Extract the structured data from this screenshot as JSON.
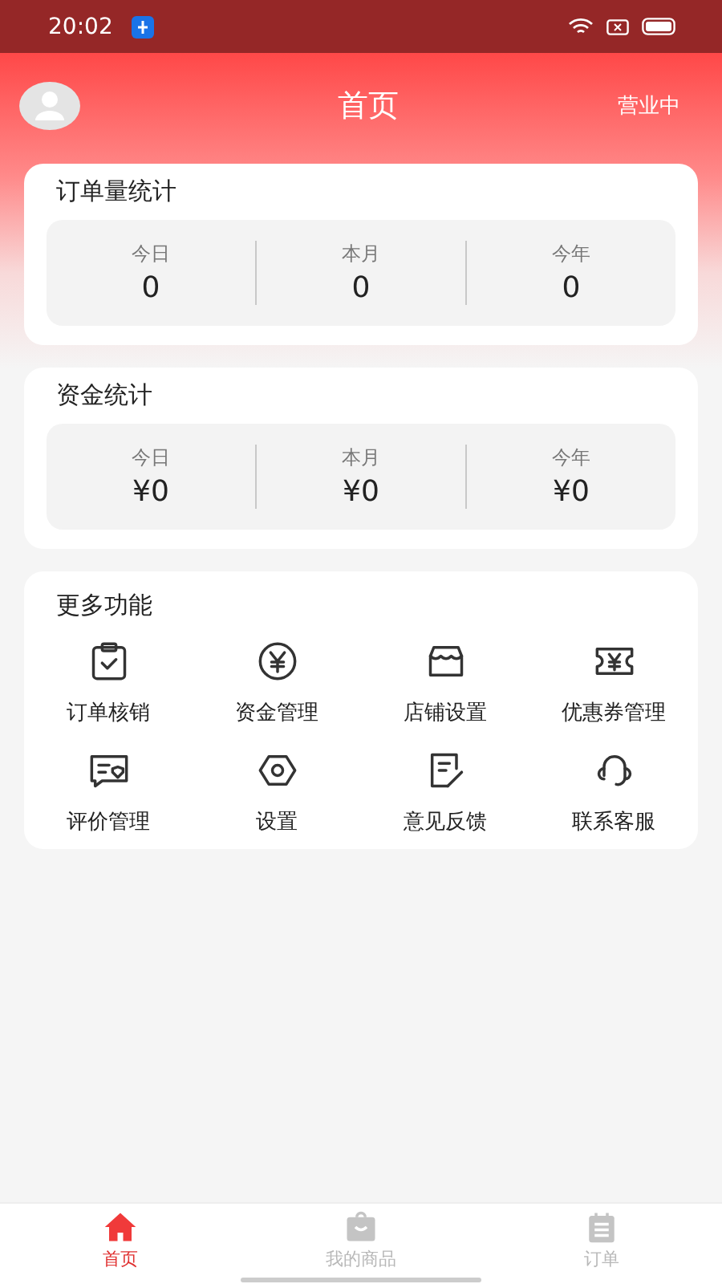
{
  "status_bar": {
    "time": "20:02"
  },
  "header": {
    "title": "首页",
    "status": "营业中"
  },
  "stat_cards": [
    {
      "title": "订单量统计",
      "stats": [
        {
          "label": "今日",
          "value": "0"
        },
        {
          "label": "本月",
          "value": "0"
        },
        {
          "label": "今年",
          "value": "0"
        }
      ]
    },
    {
      "title": "资金统计",
      "stats": [
        {
          "label": "今日",
          "value": "¥0"
        },
        {
          "label": "本月",
          "value": "¥0"
        },
        {
          "label": "今年",
          "value": "¥0"
        }
      ]
    }
  ],
  "functions": {
    "title": "更多功能",
    "items": [
      {
        "label": "订单核销"
      },
      {
        "label": "资金管理"
      },
      {
        "label": "店铺设置"
      },
      {
        "label": "优惠券管理"
      },
      {
        "label": "评价管理"
      },
      {
        "label": "设置"
      },
      {
        "label": "意见反馈"
      },
      {
        "label": "联系客服"
      }
    ]
  },
  "tab_bar": [
    {
      "label": "首页",
      "selected": true
    },
    {
      "label": "我的商品",
      "selected": false
    },
    {
      "label": "订单",
      "selected": false
    }
  ]
}
